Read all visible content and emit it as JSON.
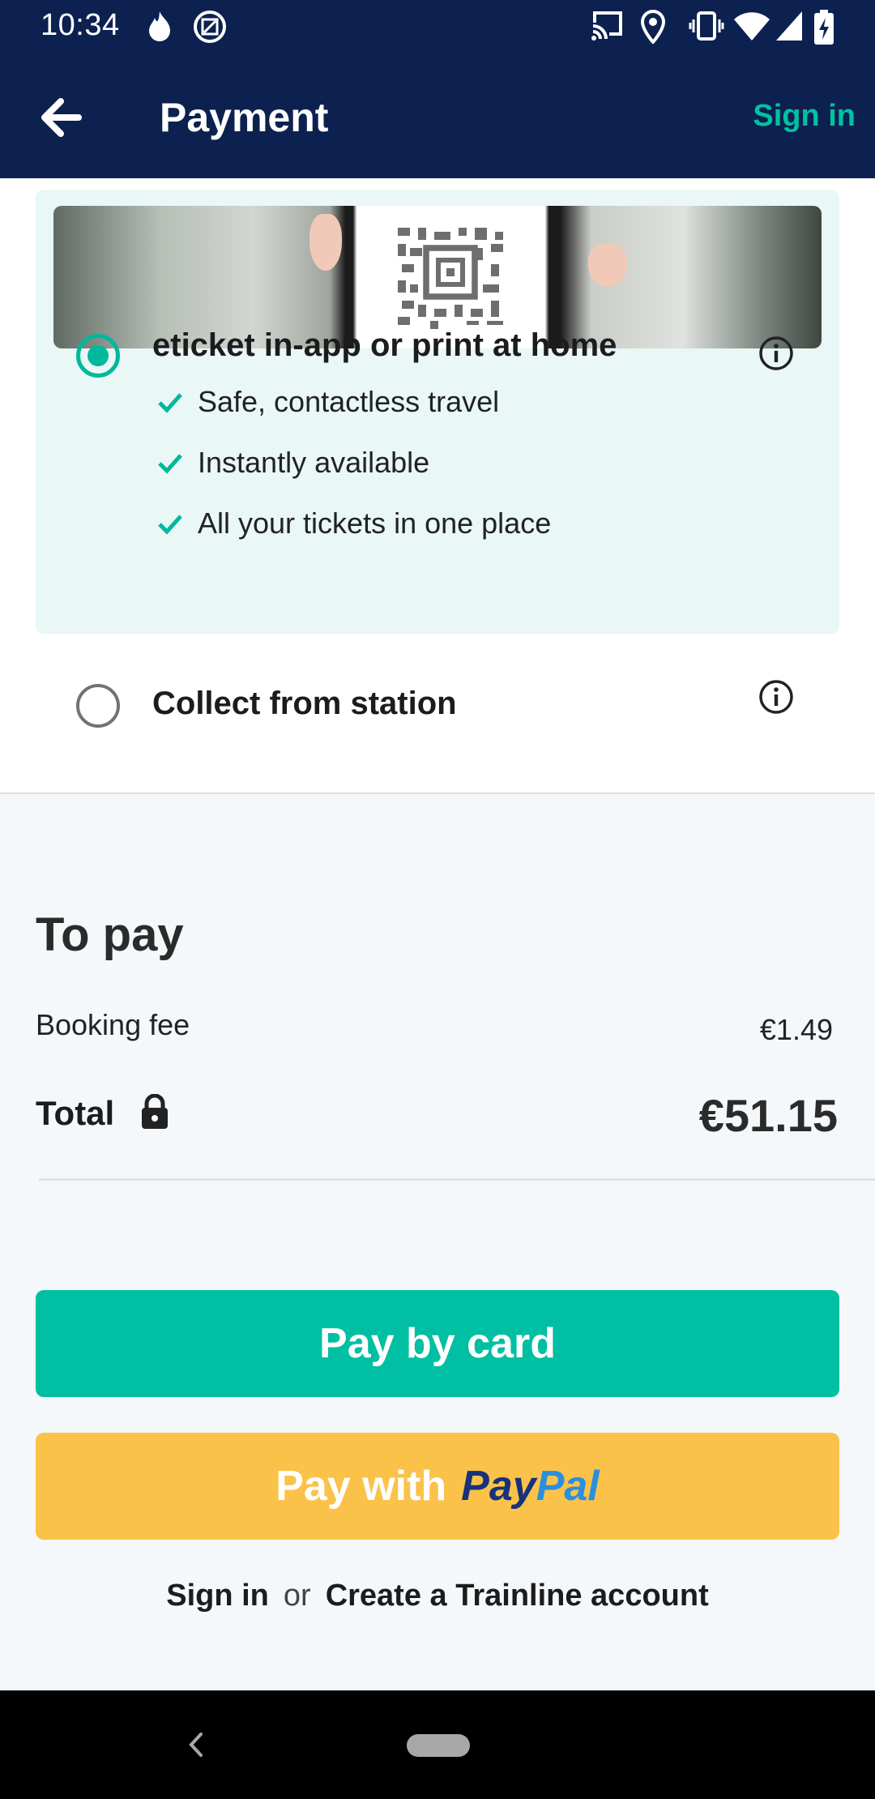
{
  "status_bar": {
    "time": "10:34",
    "left_icons": [
      "flame-icon",
      "image-notification-icon"
    ],
    "right_icons": [
      "cast-icon",
      "location-icon",
      "vibrate-icon",
      "wifi-icon",
      "cellular-icon",
      "battery-charging-icon"
    ]
  },
  "app_bar": {
    "back_icon": "arrow-left-icon",
    "title": "Payment",
    "sign_in": "Sign in",
    "background": "#0c2150",
    "accent": "#00c2a3"
  },
  "delivery": {
    "eticket": {
      "title": "eticket in-app or print at home",
      "selected": true,
      "features": [
        "Safe, contactless travel",
        "Instantly available",
        "All your tickets in one place"
      ]
    },
    "station": {
      "title": "Collect from station",
      "selected": false
    }
  },
  "summary": {
    "title": "To pay",
    "booking_fee_label": "Booking fee",
    "booking_fee_value": "€1.49",
    "total_label": "Total",
    "total_value": "€51.15"
  },
  "buttons": {
    "pay_card": "Pay by card",
    "pay_with": "Pay with",
    "paypal_pay": "Pay",
    "paypal_pal": "Pal",
    "card_color": "#00bfa2",
    "paypal_color": "#fbc24a"
  },
  "account": {
    "sign_in": "Sign in",
    "or": "or",
    "create": "Create a Trainline account"
  }
}
